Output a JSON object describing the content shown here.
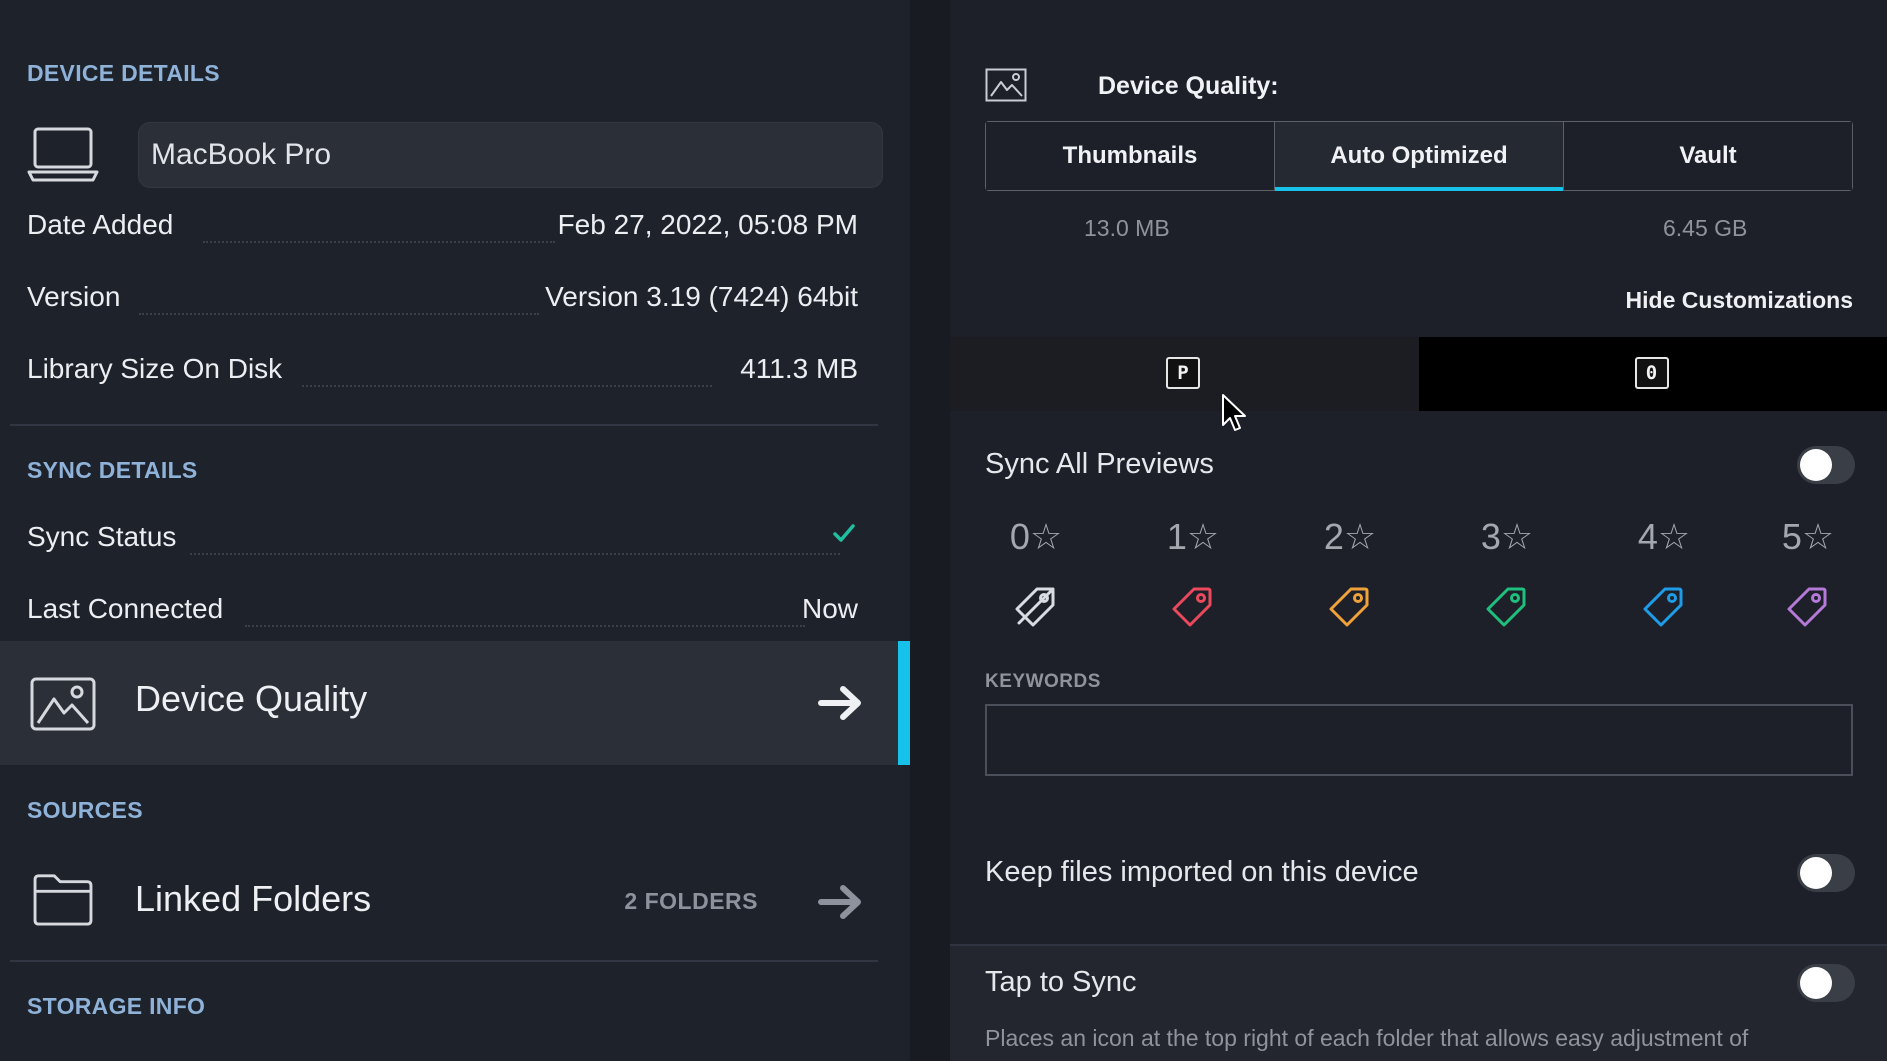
{
  "device_details": {
    "heading": "DEVICE DETAILS",
    "name_value": "MacBook Pro",
    "rows": [
      {
        "key": "Date Added",
        "value": "Feb 27, 2022, 05:08 PM"
      },
      {
        "key": "Version",
        "value": "Version 3.19 (7424) 64bit"
      },
      {
        "key": "Library Size On Disk",
        "value": "411.3 MB"
      }
    ]
  },
  "sync_details": {
    "heading": "SYNC DETAILS",
    "status_label": "Sync Status",
    "last_connected_label": "Last Connected",
    "last_connected_value": "Now"
  },
  "device_quality_nav": {
    "label": "Device Quality"
  },
  "sources": {
    "heading": "SOURCES",
    "linked_folders_label": "Linked Folders",
    "linked_folders_count": "2 FOLDERS"
  },
  "storage_info": {
    "heading": "STORAGE INFO"
  },
  "quality_panel": {
    "title": "Device Quality:",
    "options": [
      "Thumbnails",
      "Auto Optimized",
      "Vault"
    ],
    "selected": "Auto Optimized",
    "thumbnails_size": "13.0 MB",
    "vault_size": "6.45 GB",
    "hide_customizations": "Hide Customizations",
    "key_p": "P",
    "key_o": "0"
  },
  "sync_all_previews": {
    "label": "Sync All Previews",
    "on": false
  },
  "ratings": [
    "0☆",
    "1☆",
    "2☆",
    "3☆",
    "4☆",
    "5☆"
  ],
  "tag_colors": [
    "#d9dde3",
    "#ec4a5c",
    "#f0a23a",
    "#1fc07e",
    "#1e9ce8",
    "#b57ad8"
  ],
  "keywords": {
    "label": "KEYWORDS",
    "value": ""
  },
  "keep_files": {
    "label": "Keep files imported on this device",
    "on": false
  },
  "tap_to_sync": {
    "label": "Tap to Sync",
    "on": false,
    "description": "Places an icon at the top right of each folder that allows easy adjustment of"
  },
  "colors": {
    "accent": "#16c2ea",
    "section_heading": "#8fb2d8",
    "check": "#1fbfa0"
  }
}
